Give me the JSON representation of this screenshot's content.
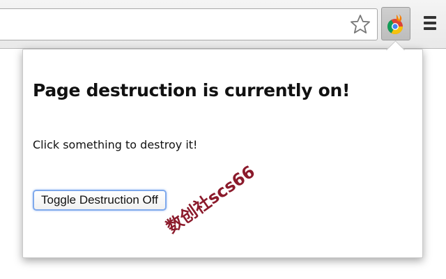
{
  "popup": {
    "title": "Page destruction is currently on!",
    "instruction": "Click something to destroy it!",
    "toggle_button_label": "Toggle Destruction Off"
  },
  "toolbar": {
    "star_icon": "bookmark-star-icon",
    "extension_icon": "chrome-extension-icon",
    "menu_icon": "hamburger-menu-icon"
  },
  "watermark": "数创社scs66",
  "colors": {
    "button_focus_border": "#7fa9ec",
    "watermark": "#8b1a2b"
  }
}
